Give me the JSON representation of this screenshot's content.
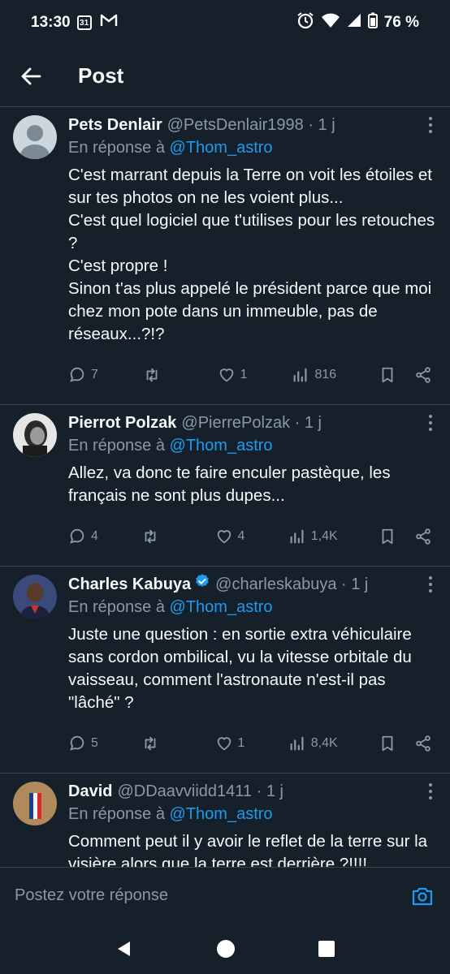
{
  "status": {
    "time": "13:30",
    "calendar_day": "31",
    "battery": "76 %"
  },
  "header": {
    "title": "Post"
  },
  "posts": [
    {
      "name": "Pets Denlair",
      "handle": "@PetsDenlair1998 · 1 j",
      "reply_prefix": "En réponse à ",
      "reply_to": "@Thom_astro",
      "text": "C'est marrant depuis la Terre on voit les étoiles et sur tes photos on ne les voient plus...\nC'est quel logiciel que t'utilises pour les retouches ?\nC'est propre !\nSinon t'as plus appelé le président parce que moi chez mon pote dans un immeuble, pas de réseaux...?!?",
      "replies": "7",
      "reposts": "",
      "likes": "1",
      "views": "816"
    },
    {
      "name": "Pierrot Polzak",
      "handle": "@PierrePolzak · 1 j",
      "reply_prefix": "En réponse à ",
      "reply_to": "@Thom_astro",
      "text": "Allez, va donc te faire enculer pastèque, les français ne sont plus dupes...",
      "replies": "4",
      "reposts": "",
      "likes": "4",
      "views": "1,4K"
    },
    {
      "name": "Charles Kabuya",
      "handle": "@charleskabuya · 1 j",
      "reply_prefix": "En réponse à ",
      "reply_to": "@Thom_astro",
      "text": "Juste une question : en sortie extra véhiculaire sans cordon ombilical, vu la vitesse orbitale du vaisseau, comment l'astronaute n'est-il pas \"lâché\" ?",
      "replies": "5",
      "reposts": "",
      "likes": "1",
      "views": "8,4K"
    },
    {
      "name": "David",
      "handle": "@DDaavviidd1411 · 1 j",
      "reply_prefix": "En réponse à ",
      "reply_to": "@Thom_astro",
      "text": "Comment peut il y avoir le reflet de la terre sur la visière alors que la terre est derrière ?!!!!\nN'importe quoi. Dis la vérité"
    }
  ],
  "composer": {
    "placeholder": "Postez votre réponse"
  },
  "colors": {
    "background": "#15202b",
    "accent": "#1d9bf0",
    "muted": "#8b98a5",
    "divider": "#38444d"
  }
}
